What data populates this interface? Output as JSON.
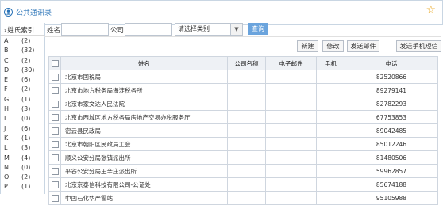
{
  "app": {
    "title": "公共通讯录"
  },
  "sidebar": {
    "header": "姓氏索引",
    "letters": [
      {
        "letter": "A",
        "count": "(2)"
      },
      {
        "letter": "B",
        "count": "(32)"
      },
      {
        "letter": "C",
        "count": "(2)"
      },
      {
        "letter": "D",
        "count": "(30)"
      },
      {
        "letter": "E",
        "count": "(6)"
      },
      {
        "letter": "F",
        "count": "(2)"
      },
      {
        "letter": "G",
        "count": "(1)"
      },
      {
        "letter": "H",
        "count": "(3)"
      },
      {
        "letter": "I",
        "count": "(0)"
      },
      {
        "letter": "J",
        "count": "(6)"
      },
      {
        "letter": "K",
        "count": "(1)"
      },
      {
        "letter": "L",
        "count": "(3)"
      },
      {
        "letter": "M",
        "count": "(4)"
      },
      {
        "letter": "N",
        "count": "(0)"
      },
      {
        "letter": "O",
        "count": "(2)"
      },
      {
        "letter": "P",
        "count": "(1)"
      }
    ]
  },
  "search": {
    "name_label": "姓名",
    "company_label": "公司",
    "category_placeholder": "请选择类别",
    "query_button": "查询"
  },
  "actions": {
    "new": "新建",
    "edit": "修改",
    "send_mail": "发送邮件",
    "send_sms": "发送手机短信"
  },
  "table": {
    "headers": {
      "name": "姓名",
      "company": "公司名称",
      "email": "电子邮件",
      "mobile": "手机",
      "phone": "电话"
    },
    "rows": [
      {
        "name": "北京市国税局",
        "company": "",
        "email": "",
        "mobile": "",
        "phone": "82520866"
      },
      {
        "name": "北京市地方税务局海淀税务所",
        "company": "",
        "email": "",
        "mobile": "",
        "phone": "89279141"
      },
      {
        "name": "北京市家文达人民法院",
        "company": "",
        "email": "",
        "mobile": "",
        "phone": "82782293"
      },
      {
        "name": "北京市西城区地方税务局房地产交易办税服务厅",
        "company": "",
        "email": "",
        "mobile": "",
        "phone": "67753853"
      },
      {
        "name": "密云县民政局",
        "company": "",
        "email": "",
        "mobile": "",
        "phone": "89042485"
      },
      {
        "name": "北京市朝阳区民政局工会",
        "company": "",
        "email": "",
        "mobile": "",
        "phone": "85012246"
      },
      {
        "name": "顺义公安分局张镇派出所",
        "company": "",
        "email": "",
        "mobile": "",
        "phone": "81480506"
      },
      {
        "name": "平谷公安分局王辛庄派出所",
        "company": "",
        "email": "",
        "mobile": "",
        "phone": "59962857"
      },
      {
        "name": "北京京泰信科技有限公司-公证处",
        "company": "",
        "email": "",
        "mobile": "",
        "phone": "85674188"
      },
      {
        "name": "中国石化华严霍站",
        "company": "",
        "email": "",
        "mobile": "",
        "phone": "95105988"
      }
    ]
  }
}
